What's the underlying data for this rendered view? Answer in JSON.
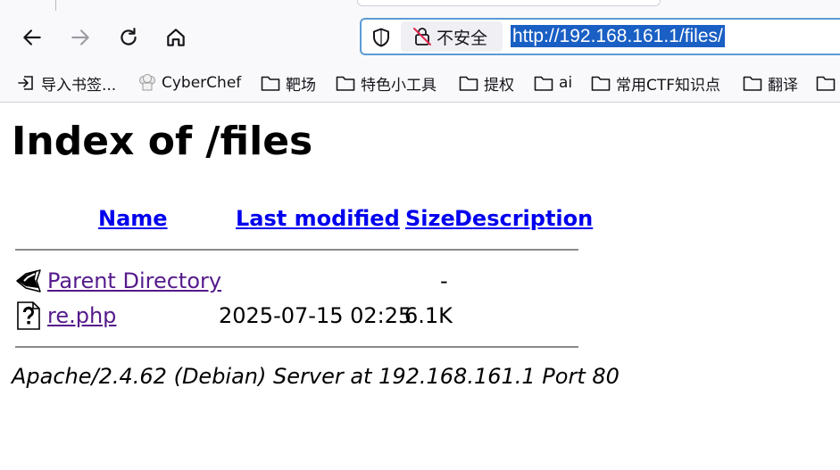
{
  "browser": {
    "security_label": "不安全",
    "url": "http://192.168.161.1/files/",
    "bookmarks": [
      {
        "label": "导入书签...",
        "icon": "import-icon"
      },
      {
        "label": "CyberChef",
        "icon": "chef-hat-icon"
      },
      {
        "label": "靶场",
        "icon": "folder-icon"
      },
      {
        "label": "特色小工具",
        "icon": "folder-icon"
      },
      {
        "label": "提权",
        "icon": "folder-icon"
      },
      {
        "label": "ai",
        "icon": "folder-icon"
      },
      {
        "label": "常用CTF知识点",
        "icon": "folder-icon"
      },
      {
        "label": "翻译",
        "icon": "folder-icon"
      }
    ]
  },
  "page": {
    "title": "Index of /files",
    "columns": {
      "name": "Name",
      "last_modified": "Last modified",
      "size": "Size",
      "description": "Description"
    },
    "rows": [
      {
        "name": "Parent Directory",
        "last_modified": "",
        "size": "-",
        "description": "",
        "icon": "back-arrow-icon"
      },
      {
        "name": "re.php",
        "last_modified": "2025-07-15 02:25",
        "size": "6.1K",
        "description": "",
        "icon": "unknown-file-icon"
      }
    ],
    "footer": "Apache/2.4.62 (Debian) Server at 192.168.161.1 Port 80"
  }
}
